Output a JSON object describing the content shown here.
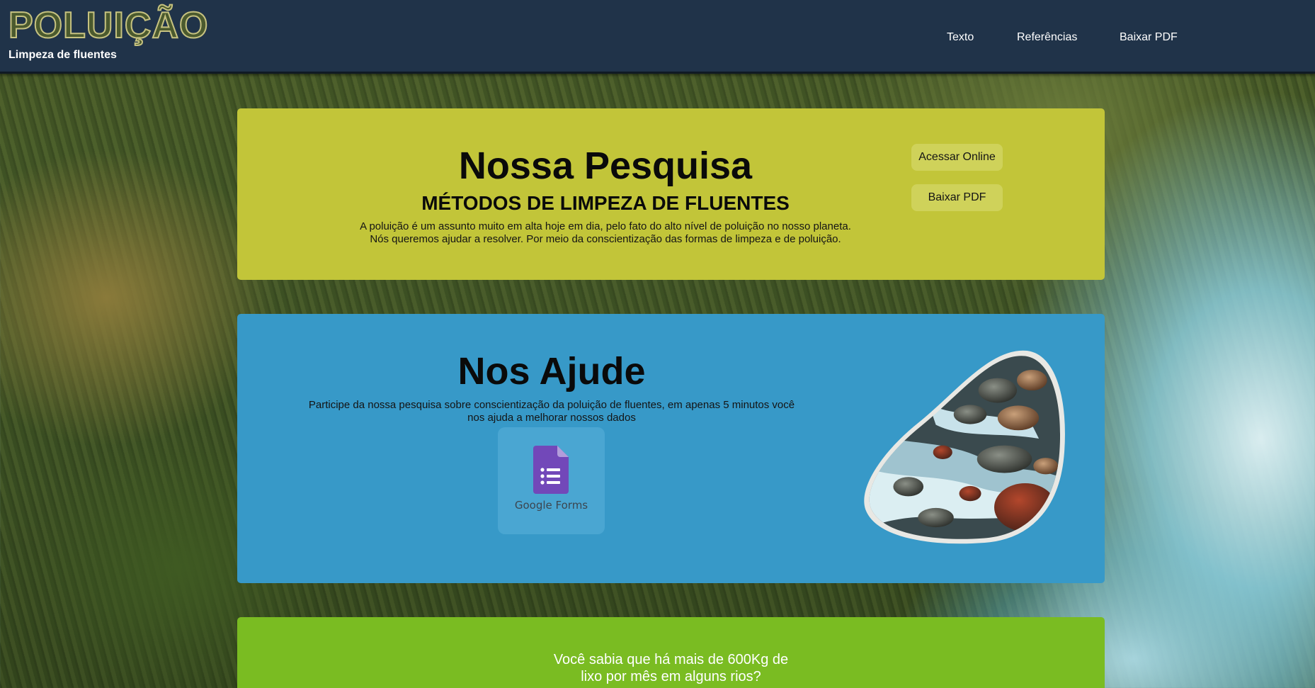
{
  "header": {
    "brand_title": "POLUIÇÃO",
    "brand_subtitle": "Limpeza de fluentes",
    "nav": [
      {
        "label": "Texto"
      },
      {
        "label": "Referências"
      },
      {
        "label": "Baixar PDF"
      }
    ]
  },
  "research": {
    "title": "Nossa Pesquisa",
    "subtitle": "MÉTODOS DE LIMPEZA DE FLUENTES",
    "text_line1": "A poluição é um assunto muito em alta hoje em dia, pelo fato do alto nível de poluição no nosso planeta.",
    "text_line2": "Nós queremos ajudar a resolver. Por meio da conscientização das formas de limpeza e de poluição.",
    "buttons": [
      {
        "label": "Acessar Online"
      },
      {
        "label": "Baixar PDF"
      }
    ]
  },
  "help": {
    "title": "Nos Ajude",
    "text_line1": "Participe da nossa pesquisa sobre conscientização da poluição de fluentes, em apenas 5 minutos você",
    "text_line2": "nos ajuda a melhorar nossos dados",
    "forms_label": "Google Forms",
    "icon": "google-forms-icon"
  },
  "fact": {
    "line1": "Você sabia que há mais de 600Kg de",
    "line2": "lixo por mês em alguns rios?"
  },
  "colors": {
    "header_bg": "#203349",
    "research_bg": "#c2c539",
    "help_bg": "#3799c8",
    "fact_bg": "#7abc22",
    "forms_purple": "#7248b9"
  }
}
